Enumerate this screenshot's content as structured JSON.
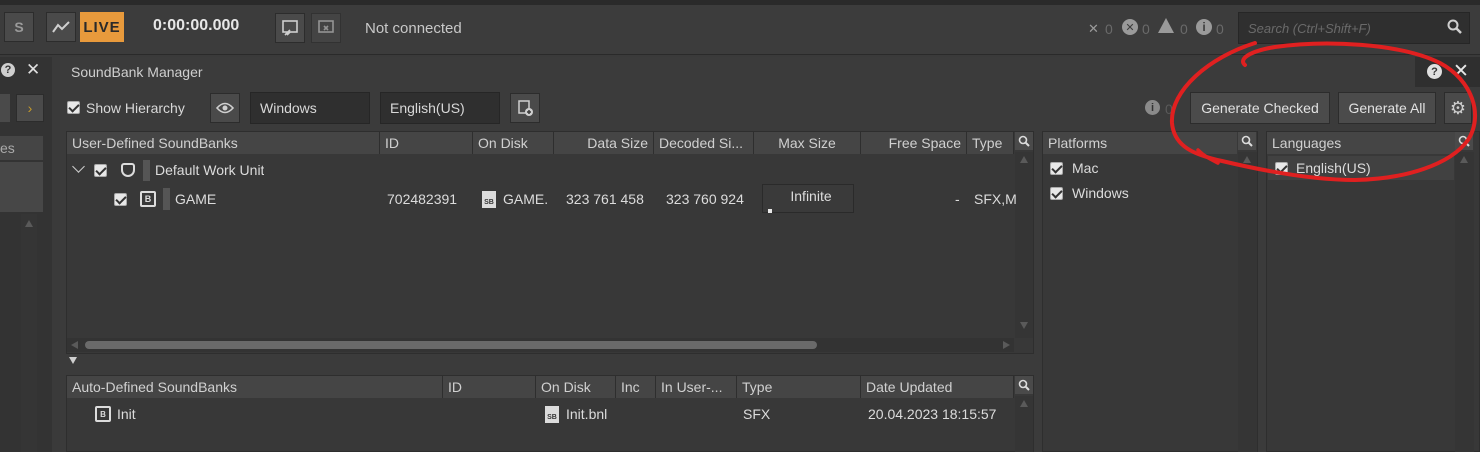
{
  "toolbar": {
    "s_label": "S",
    "live_label": "LIVE",
    "time": "0:00:00.000",
    "status": "Not connected",
    "counters": [
      "0",
      "0",
      "0",
      "0"
    ],
    "search_placeholder": "Search (Ctrl+Shift+F)"
  },
  "left_panel": {
    "partial_label": "es"
  },
  "window": {
    "title": "SoundBank Manager"
  },
  "controls": {
    "show_hierarchy": "Show Hierarchy",
    "platform": "Windows",
    "language": "English(US)",
    "info_count": "0",
    "generate_checked": "Generate Checked",
    "generate_all": "Generate All"
  },
  "user_banks": {
    "columns": [
      "User-Defined SoundBanks",
      "ID",
      "On Disk",
      "Data Size",
      "Decoded Si...",
      "Max Size",
      "Free Space",
      "Type"
    ],
    "work_unit": "Default Work Unit",
    "row": {
      "name": "GAME",
      "id": "702482391",
      "on_disk": "GAME.",
      "data_size": "323 761 458",
      "decoded_size": "323 760 924",
      "max_size": "Infinite",
      "free_space": "-",
      "type": "SFX,M"
    },
    "scroll_fraction": 0.5
  },
  "auto_banks": {
    "columns": [
      "Auto-Defined SoundBanks",
      "ID",
      "On Disk",
      "Inc",
      "In User-...",
      "Type",
      "Date Updated"
    ],
    "row": {
      "name": "Init",
      "on_disk": "Init.bnl",
      "type": "SFX",
      "date_updated": "20.04.2023 18:15:57"
    }
  },
  "platforms": {
    "header": "Platforms",
    "items": [
      "Mac",
      "Windows"
    ]
  },
  "languages": {
    "header": "Languages",
    "items": [
      "English(US)"
    ]
  },
  "annotation_color": "#e02020"
}
